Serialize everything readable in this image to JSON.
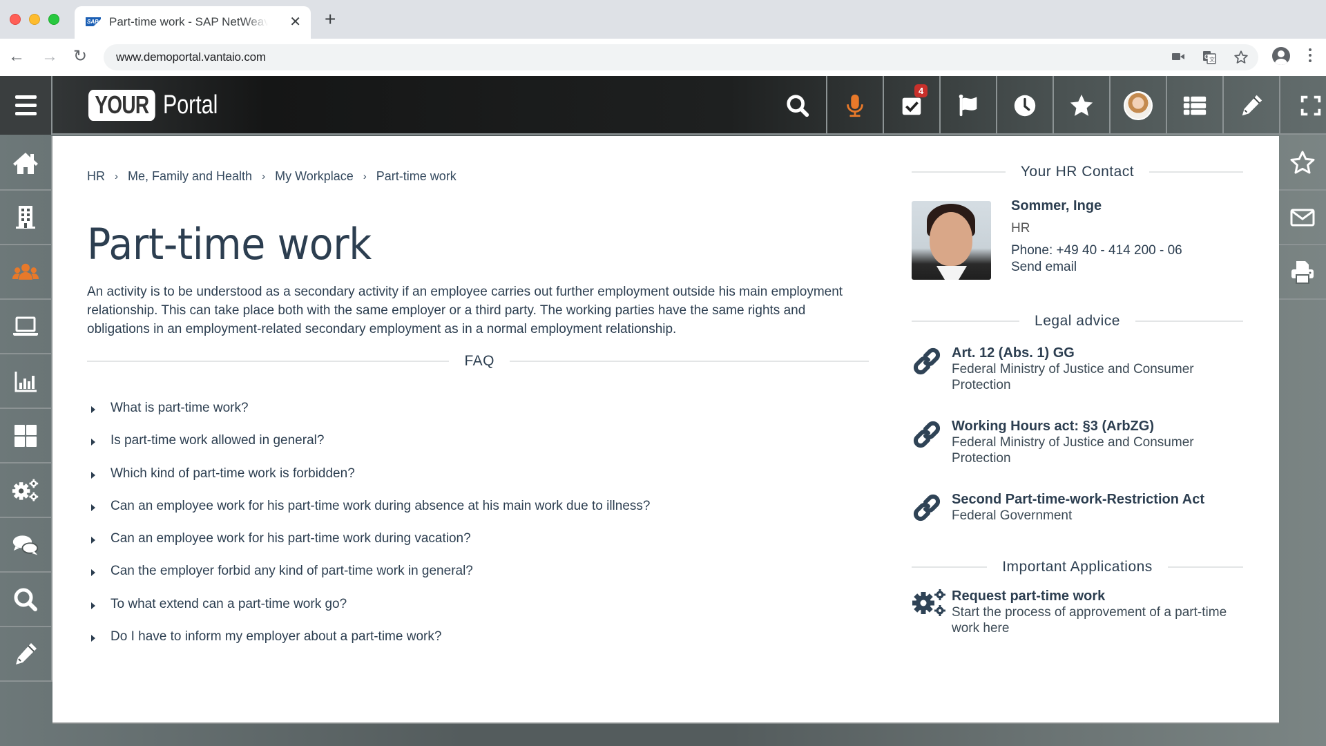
{
  "browser": {
    "tab_title": "Part-time work - SAP NetWeaver Portal",
    "favicon_text": "SAP",
    "url": "www.demoportal.vantaio.com"
  },
  "portal": {
    "logo_your": "YOUR",
    "logo_portal": "Portal",
    "notifications_count": "4",
    "accent_color": "#e8792a",
    "badge_color": "#c8302b",
    "top_actions": [
      "search-icon",
      "microphone-icon",
      "tasks-icon",
      "flag-icon",
      "clock-icon",
      "favorites-icon",
      "user-avatar",
      "list-icon",
      "edit-icon",
      "fullscreen-icon"
    ],
    "left_rail": [
      "home-icon",
      "building-icon",
      "people-icon",
      "laptop-icon",
      "chart-icon",
      "dashboard-icon",
      "settings-icon",
      "chat-icon",
      "search-icon",
      "edit-icon"
    ],
    "right_rail": [
      "bookmark-icon",
      "mail-icon",
      "print-icon"
    ],
    "active_left_item": "people-icon"
  },
  "main": {
    "breadcrumb": [
      "HR",
      "Me, Family and Health",
      "My Workplace",
      "Part-time work"
    ],
    "breadcrumb_separator": "›",
    "title": "Part-time work",
    "intro": "An activity is to be understood as a secondary activity if an employee carries out further employment outside his main employment relationship. This can take place both with the same employer or a third party. The working parties have the same rights and obligations in an employment-related secondary employment as in a normal employment relationship.",
    "faq_heading": "FAQ",
    "faq": [
      "What is part-time work?",
      "Is part-time work allowed in general?",
      "Which kind of part-time work is forbidden?",
      "Can an employee work for his part-time work during absence at his main work due to illness?",
      "Can an employee work for his part-time work during vacation?",
      "Can the employer forbid any kind of part-time work in general?",
      "To what extend can a part-time work go?",
      "Do I have to inform my employer about a part-time work?"
    ]
  },
  "side": {
    "contact_heading": "Your HR Contact",
    "contact": {
      "name": "Sommer, Inge",
      "department": "HR",
      "phone": "Phone: +49 40 - 414 200 - 06",
      "email_link": "Send email"
    },
    "legal_heading": "Legal advice",
    "legal": [
      {
        "title": "Art. 12 (Abs. 1) GG",
        "source": "Federal Ministry of Justice and Consumer Protection"
      },
      {
        "title": "Working Hours act: §3 (ArbZG)",
        "source": "Federal Ministry of Justice and Consumer Protection"
      },
      {
        "title": "Second Part-time-work-Restriction Act",
        "source": "Federal Government"
      }
    ],
    "apps_heading": "Important Applications",
    "apps": [
      {
        "title": "Request part-time work",
        "description": "Start the process of approvement of a part-time work here"
      }
    ]
  }
}
